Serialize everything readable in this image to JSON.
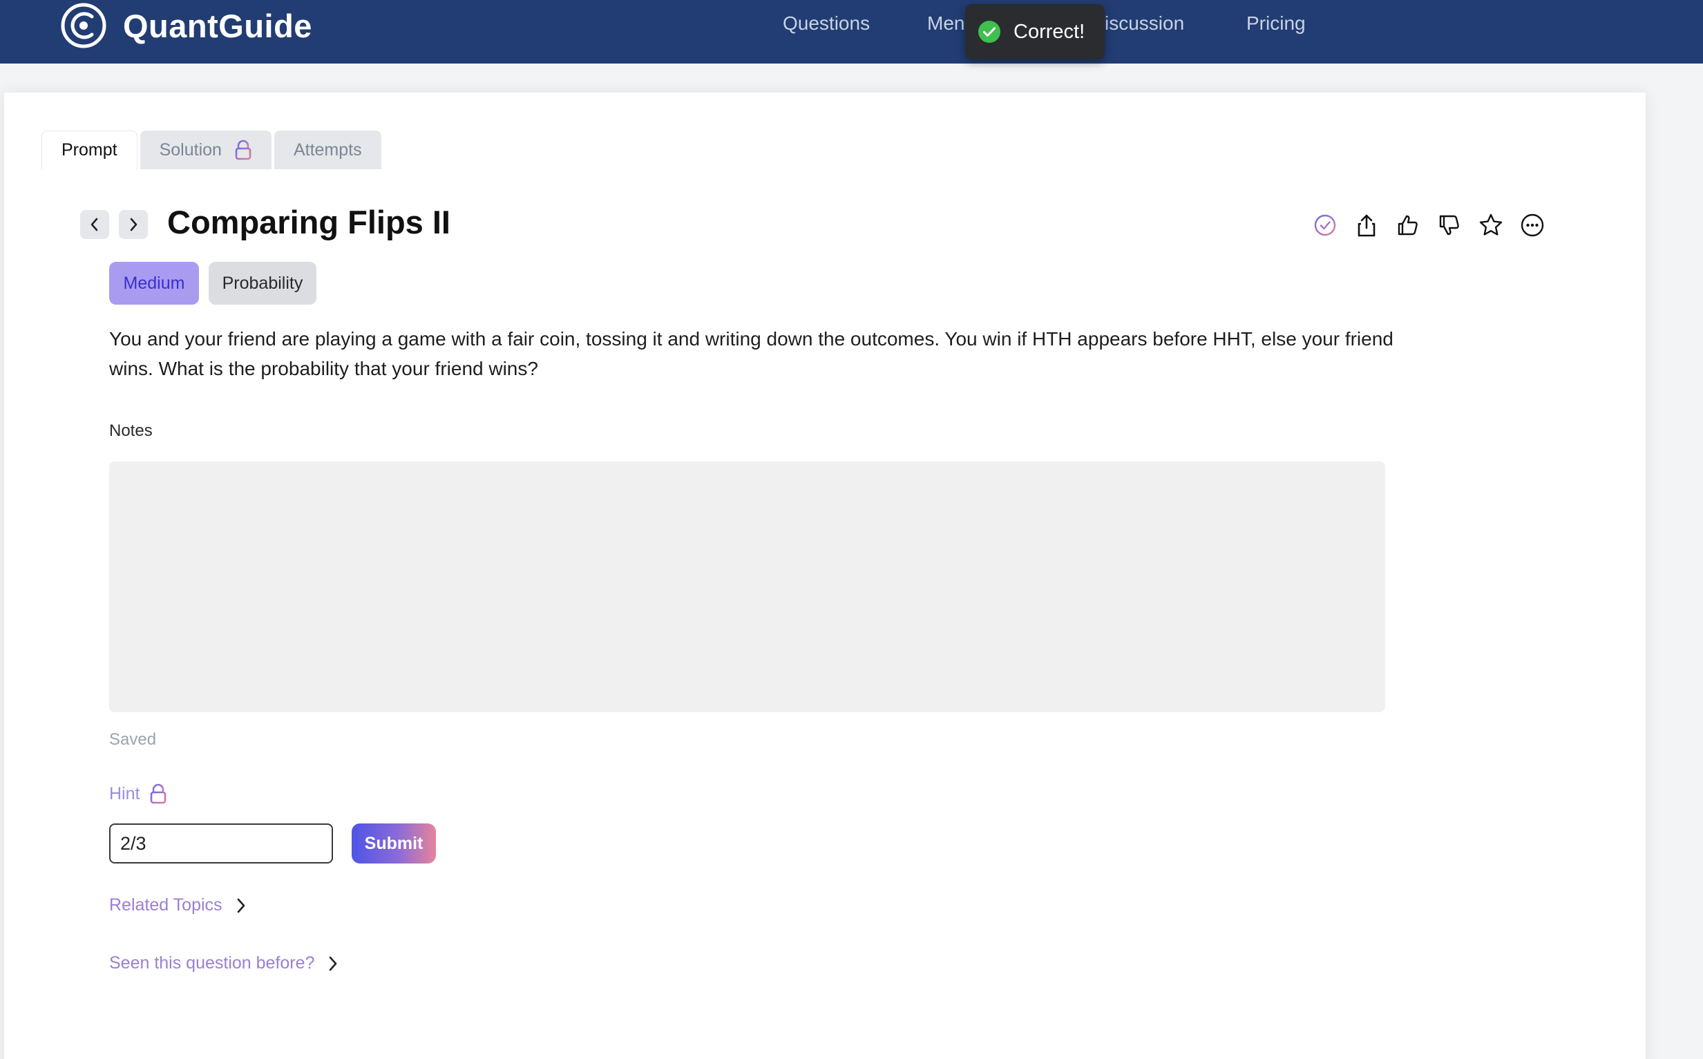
{
  "header": {
    "brand": "QuantGuide",
    "nav": [
      "Questions",
      "Men",
      "iscussion",
      "Pricing"
    ]
  },
  "toast": {
    "text": "Correct!",
    "icon": "check-circle-icon"
  },
  "tabs": [
    {
      "label": "Prompt",
      "active": true
    },
    {
      "label": "Solution",
      "locked": true
    },
    {
      "label": "Attempts"
    }
  ],
  "question": {
    "title": "Comparing Flips II",
    "difficulty": "Medium",
    "topic": "Probability",
    "prompt": "You and your friend are playing a game with a fair coin, tossing it and writing down the outcomes. You win if HTH appears before HHT, else your friend wins. What is the probability that your friend wins?"
  },
  "actions": [
    "completed-check-icon",
    "share-icon",
    "thumbs-up-icon",
    "thumbs-down-icon",
    "star-icon",
    "more-icon"
  ],
  "notes": {
    "label": "Notes",
    "value": "",
    "status": "Saved"
  },
  "hint": {
    "label": "Hint",
    "locked": true
  },
  "answer": {
    "value": "2/3",
    "submit_label": "Submit"
  },
  "links": {
    "related": "Related Topics",
    "seen": "Seen this question before?"
  },
  "colors": {
    "nav_bg": "#223d73",
    "accent_purple": "#9b8de0",
    "difficulty_bg": "#a99cf0",
    "toast_bg": "#2a2c2f",
    "success": "#3fbf4e"
  }
}
